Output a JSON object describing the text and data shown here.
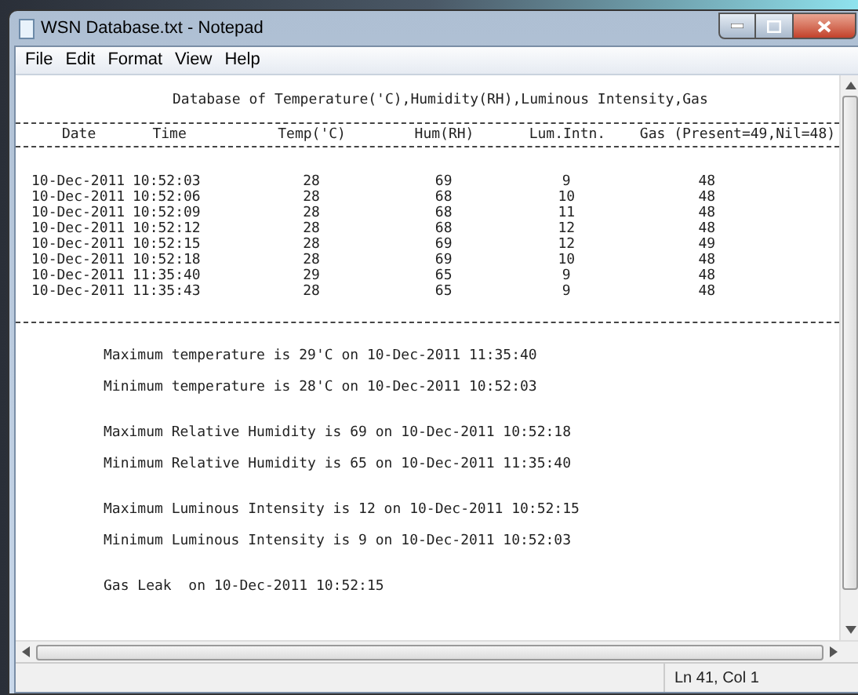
{
  "window": {
    "title": "WSN Database.txt - Notepad"
  },
  "menu": [
    "File",
    "Edit",
    "Format",
    "View",
    "Help"
  ],
  "document": {
    "title": "Database of Temperature('C),Humidity(RH),Luminous Intensity,Gas",
    "columns": [
      "Date",
      "Time",
      "Temp('C)",
      "Hum(RH)",
      "Lum.Intn.",
      "Gas (Present=49,Nil=48)"
    ],
    "rows": [
      [
        "10-Dec-2011",
        "10:52:03",
        "28",
        "69",
        "9",
        "48"
      ],
      [
        "10-Dec-2011",
        "10:52:06",
        "28",
        "68",
        "10",
        "48"
      ],
      [
        "10-Dec-2011",
        "10:52:09",
        "28",
        "68",
        "11",
        "48"
      ],
      [
        "10-Dec-2011",
        "10:52:12",
        "28",
        "68",
        "12",
        "48"
      ],
      [
        "10-Dec-2011",
        "10:52:15",
        "28",
        "69",
        "12",
        "49"
      ],
      [
        "10-Dec-2011",
        "10:52:18",
        "28",
        "69",
        "10",
        "48"
      ],
      [
        "10-Dec-2011",
        "11:35:40",
        "29",
        "65",
        "9",
        "48"
      ],
      [
        "10-Dec-2011",
        "11:35:43",
        "28",
        "65",
        "9",
        "48"
      ]
    ],
    "summary_groups": [
      [
        "Maximum temperature is 29'C on 10-Dec-2011 11:35:40",
        "Minimum temperature is 28'C on 10-Dec-2011 10:52:03"
      ],
      [
        "Maximum Relative Humidity is 69 on 10-Dec-2011 10:52:18",
        "Minimum Relative Humidity is 65 on 10-Dec-2011 11:35:40"
      ],
      [
        "Maximum Luminous Intensity is 12 on 10-Dec-2011 10:52:15",
        "Minimum Luminous Intensity is 9 on 10-Dec-2011 10:52:03"
      ],
      [
        "Gas Leak  on 10-Dec-2011 10:52:15"
      ]
    ]
  },
  "status_bar": {
    "position": "Ln 41, Col 1"
  }
}
